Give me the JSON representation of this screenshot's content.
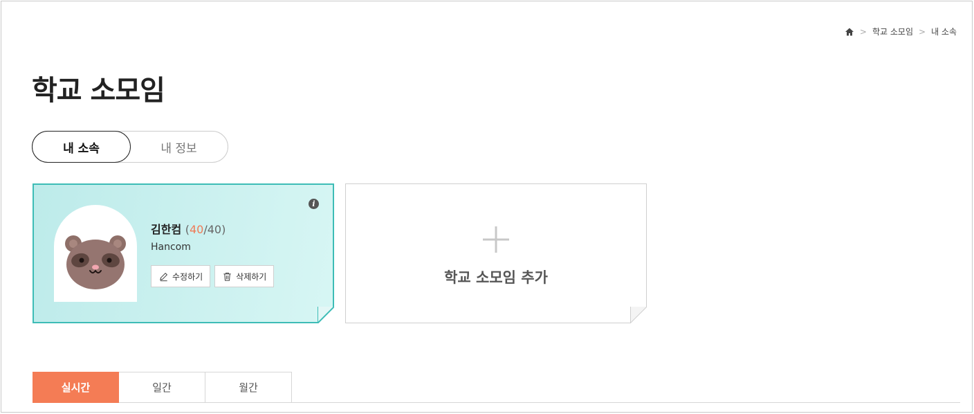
{
  "breadcrumb": {
    "icon": "home-icon",
    "items": [
      "학교 소모임",
      "내 소속"
    ],
    "separator": ">"
  },
  "page_title": "학교 소모임",
  "segment": {
    "tabs": [
      "내 소속",
      "내 정보"
    ],
    "active_index": 0
  },
  "club_card": {
    "name": "김한컴",
    "count_open": "(",
    "count_current": "40",
    "count_sep": "/",
    "count_max": "40",
    "count_close": ")",
    "school": "Hancom",
    "edit_label": "수정하기",
    "delete_label": "삭제하기",
    "info_glyph": "i",
    "colors": {
      "border": "#3dbcb6",
      "background": "#c9f0ee",
      "count_accent": "#f07a55"
    }
  },
  "add_card": {
    "label": "학교 소모임 추가"
  },
  "period_tabs": {
    "items": [
      "실시간",
      "일간",
      "월간"
    ],
    "active_index": 0,
    "active_color": "#f47c55"
  }
}
